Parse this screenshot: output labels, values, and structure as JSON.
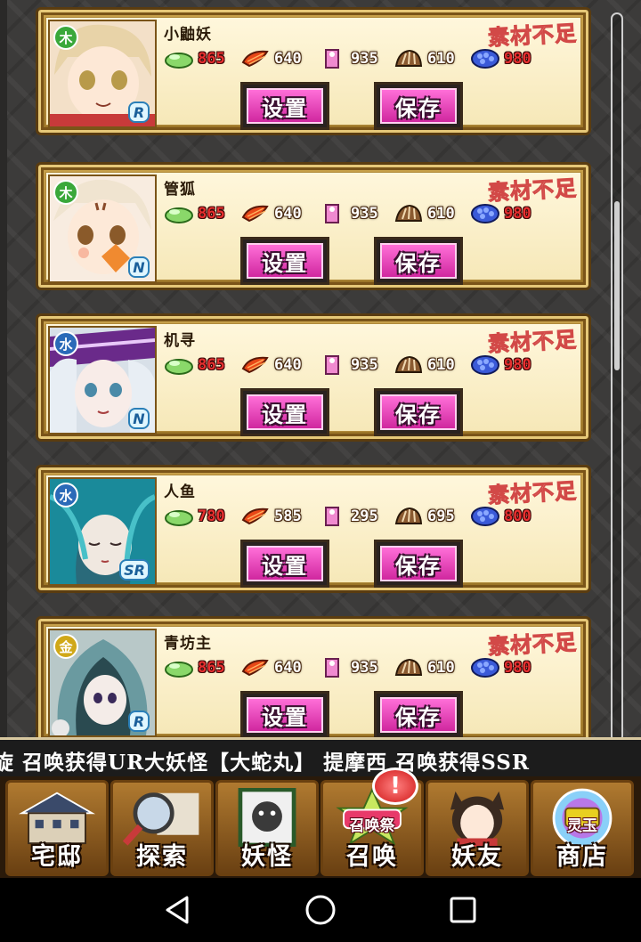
{
  "cards": [
    {
      "name": "小鼬妖",
      "attribute": "木",
      "attr_color": "#3aa83a",
      "rarity": "R",
      "status": "素材不足",
      "materials": [
        {
          "icon": "green-orb-icon",
          "value": "865",
          "lacking": true
        },
        {
          "icon": "red-scale-icon",
          "value": "640",
          "lacking": false
        },
        {
          "icon": "pink-talisman-icon",
          "value": "935",
          "lacking": false
        },
        {
          "icon": "brown-shell-icon",
          "value": "610",
          "lacking": false
        },
        {
          "icon": "blue-crystal-icon",
          "value": "980",
          "lacking": true
        }
      ],
      "set_label": "设置",
      "save_label": "保存"
    },
    {
      "name": "管狐",
      "attribute": "木",
      "attr_color": "#3aa83a",
      "rarity": "N",
      "status": "素材不足",
      "materials": [
        {
          "icon": "green-orb-icon",
          "value": "865",
          "lacking": true
        },
        {
          "icon": "red-scale-icon",
          "value": "640",
          "lacking": false
        },
        {
          "icon": "pink-talisman-icon",
          "value": "935",
          "lacking": false
        },
        {
          "icon": "brown-shell-icon",
          "value": "610",
          "lacking": false
        },
        {
          "icon": "blue-crystal-icon",
          "value": "980",
          "lacking": true
        }
      ],
      "set_label": "设置",
      "save_label": "保存"
    },
    {
      "name": "机寻",
      "attribute": "水",
      "attr_color": "#2a6ab8",
      "rarity": "N",
      "status": "素材不足",
      "materials": [
        {
          "icon": "green-orb-icon",
          "value": "865",
          "lacking": true
        },
        {
          "icon": "red-scale-icon",
          "value": "640",
          "lacking": false
        },
        {
          "icon": "pink-talisman-icon",
          "value": "935",
          "lacking": false
        },
        {
          "icon": "brown-shell-icon",
          "value": "610",
          "lacking": false
        },
        {
          "icon": "blue-crystal-icon",
          "value": "980",
          "lacking": true
        }
      ],
      "set_label": "设置",
      "save_label": "保存"
    },
    {
      "name": "人鱼",
      "attribute": "水",
      "attr_color": "#2a6ab8",
      "rarity": "SR",
      "status": "素材不足",
      "materials": [
        {
          "icon": "green-orb-icon",
          "value": "780",
          "lacking": true
        },
        {
          "icon": "red-scale-icon",
          "value": "585",
          "lacking": false
        },
        {
          "icon": "pink-talisman-icon",
          "value": "295",
          "lacking": false
        },
        {
          "icon": "brown-shell-icon",
          "value": "695",
          "lacking": false
        },
        {
          "icon": "blue-crystal-icon",
          "value": "800",
          "lacking": true
        }
      ],
      "set_label": "设置",
      "save_label": "保存"
    },
    {
      "name": "青坊主",
      "attribute": "金",
      "attr_color": "#d0a818",
      "rarity": "R",
      "status": "素材不足",
      "materials": [
        {
          "icon": "green-orb-icon",
          "value": "865",
          "lacking": true
        },
        {
          "icon": "red-scale-icon",
          "value": "640",
          "lacking": false
        },
        {
          "icon": "pink-talisman-icon",
          "value": "935",
          "lacking": false
        },
        {
          "icon": "brown-shell-icon",
          "value": "610",
          "lacking": false
        },
        {
          "icon": "blue-crystal-icon",
          "value": "980",
          "lacking": true
        }
      ],
      "set_label": "设置",
      "save_label": "保存"
    }
  ],
  "ticker": {
    "text": "旋 召唤获得UR大妖怪【大蛇丸】   提摩西 召唤获得SSR"
  },
  "nav": [
    {
      "label": "宅邸",
      "icon": "mansion-icon"
    },
    {
      "label": "探索",
      "icon": "magnifier-map-icon"
    },
    {
      "label": "妖怪",
      "icon": "scroll-monster-icon"
    },
    {
      "label": "召唤",
      "icon": "summon-festival-icon",
      "banner": "召唤祭"
    },
    {
      "label": "妖友",
      "icon": "catgirl-friend-icon"
    },
    {
      "label": "商店",
      "icon": "spirit-jade-orb-icon",
      "banner": "灵玉"
    }
  ],
  "summon_badge": "!",
  "system_nav": {
    "back": "back-icon",
    "home": "home-icon",
    "recents": "recents-icon"
  }
}
